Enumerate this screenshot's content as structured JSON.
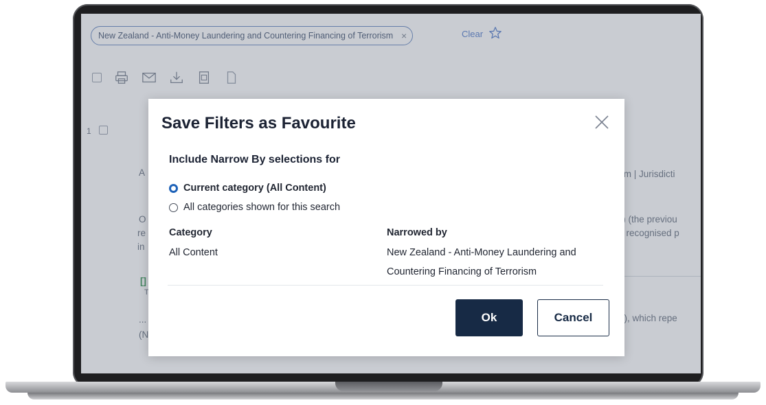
{
  "background": {
    "filter_chip": "New Zealand - Anti-Money Laundering and Countering Financing of Terrorism",
    "chip_close": "×",
    "clear_link": "Clear",
    "result_number": "1",
    "fragments": {
      "a1": "A",
      "jurisdiction": "ism | Jurisdicti",
      "o1": "O",
      "re": "re",
      "in": "in",
      "prev": "Z) (the previou",
      "recog": "ly recognised p",
      "bracket": "[]",
      "t": "T",
      "dots": "...",
      "n": "(N",
      "repe": "ct), which repe"
    }
  },
  "modal": {
    "title": "Save Filters as Favourite",
    "section_title": "Include Narrow By selections for",
    "options": [
      {
        "label": "Current category (All Content)",
        "selected": true
      },
      {
        "label": "All categories shown for this search",
        "selected": false
      }
    ],
    "category_header": "Category",
    "category_value": "All Content",
    "narrowed_header": "Narrowed by",
    "narrowed_line1": "New Zealand - Anti-Money Laundering and",
    "narrowed_line2": "Countering Financing of Terrorism",
    "ok_label": "Ok",
    "cancel_label": "Cancel"
  },
  "colors": {
    "primary_button": "#172a45",
    "radio_selected": "#1e62b8",
    "link": "#4a72c4"
  },
  "icons": [
    "star-icon",
    "print-icon",
    "email-icon",
    "download-icon",
    "document-icon",
    "file-icon",
    "close-icon"
  ]
}
